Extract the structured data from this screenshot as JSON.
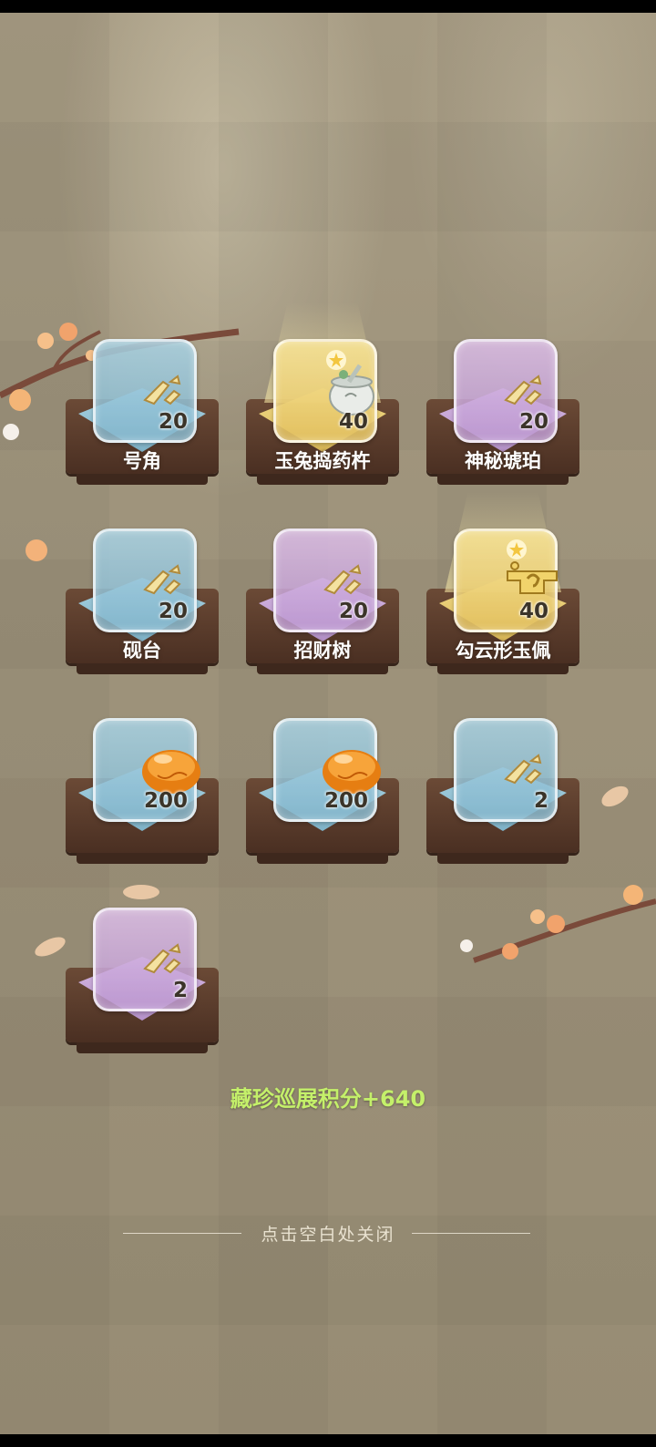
{
  "rewards": [
    {
      "label": "号角",
      "count": "20",
      "rarity": "blue",
      "icon": "shard-icon"
    },
    {
      "label": "玉兔捣药杵",
      "count": "40",
      "rarity": "gold",
      "icon": "jade-mortar-icon"
    },
    {
      "label": "神秘琥珀",
      "count": "20",
      "rarity": "purple",
      "icon": "shard-icon"
    },
    {
      "label": "砚台",
      "count": "20",
      "rarity": "blue",
      "icon": "shard-icon"
    },
    {
      "label": "招财树",
      "count": "20",
      "rarity": "purple",
      "icon": "shard-icon"
    },
    {
      "label": "勾云形玉佩",
      "count": "40",
      "rarity": "gold",
      "icon": "jade-pendant-icon"
    },
    {
      "label": "",
      "count": "200",
      "rarity": "blue",
      "icon": "amber-stone-icon"
    },
    {
      "label": "",
      "count": "200",
      "rarity": "blue",
      "icon": "amber-stone-icon"
    },
    {
      "label": "",
      "count": "2",
      "rarity": "blue",
      "icon": "shard-icon"
    },
    {
      "label": "",
      "count": "2",
      "rarity": "purple",
      "icon": "shard-icon"
    }
  ],
  "points_text": "藏珍巡展积分+640",
  "close_hint": "点击空白处关闭",
  "colors": {
    "points": "#c4f06a",
    "blue": "#a9d3e2",
    "purple": "#d7b9e4",
    "gold": "#f3dd8a"
  }
}
